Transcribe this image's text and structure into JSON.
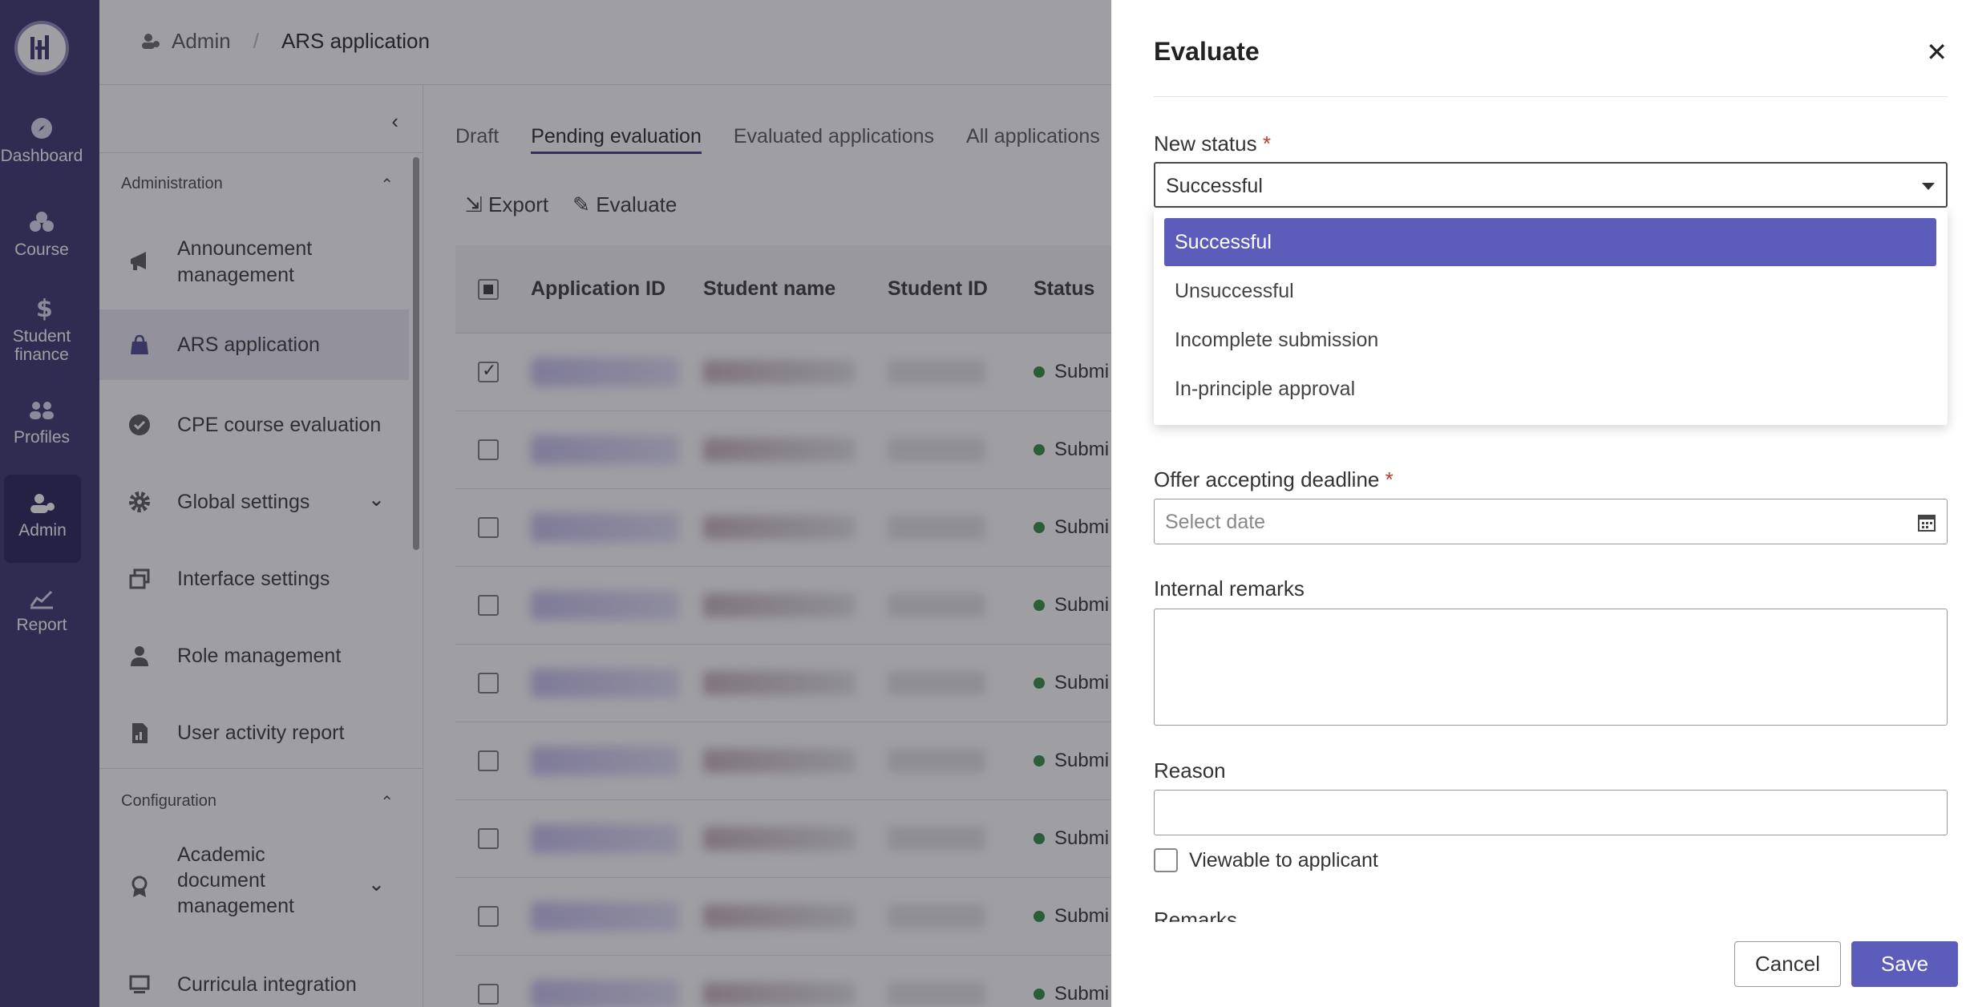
{
  "rail": {
    "items": [
      {
        "label": "Dashboard",
        "icon": "compass-icon"
      },
      {
        "label": "Course",
        "icon": "course-icon"
      },
      {
        "label": "Student finance",
        "icon": "dollar-icon"
      },
      {
        "label": "Profiles",
        "icon": "people-icon"
      },
      {
        "label": "Admin",
        "icon": "admin-icon"
      },
      {
        "label": "Report",
        "icon": "chart-icon"
      }
    ]
  },
  "breadcrumb": {
    "parent": "Admin",
    "current": "ARS application"
  },
  "sidebar": {
    "groups": {
      "administration": "Administration",
      "configuration": "Configuration"
    },
    "items": [
      {
        "label": "Announcement management"
      },
      {
        "label": "ARS application"
      },
      {
        "label": "CPE course evaluation"
      },
      {
        "label": "Global settings"
      },
      {
        "label": "Interface settings"
      },
      {
        "label": "Role management"
      },
      {
        "label": "User activity report"
      },
      {
        "label": "Academic document management"
      },
      {
        "label": "Curricula integration"
      }
    ]
  },
  "tabs": [
    "Draft",
    "Pending evaluation",
    "Evaluated applications",
    "All applications"
  ],
  "toolbar": {
    "export": "Export",
    "evaluate": "Evaluate"
  },
  "table": {
    "columns": [
      "Application ID",
      "Student name",
      "Student ID",
      "Status"
    ],
    "status_text": "Submi"
  },
  "panel": {
    "title": "Evaluate",
    "new_status_label": "New status",
    "required_mark": "*",
    "selected": "Successful",
    "options": [
      "Successful",
      "Unsuccessful",
      "Incomplete submission",
      "In-principle approval"
    ],
    "deadline_label": "Offer accepting deadline",
    "deadline_placeholder": "Select date",
    "internal_remarks_label": "Internal remarks",
    "reason_label": "Reason",
    "viewable_label": "Viewable to applicant",
    "remarks_label": "Remarks",
    "cancel": "Cancel",
    "save": "Save"
  },
  "colors": {
    "rail": "#37306b",
    "accent": "#5c5cbb",
    "status_green": "#2e8b3c"
  }
}
